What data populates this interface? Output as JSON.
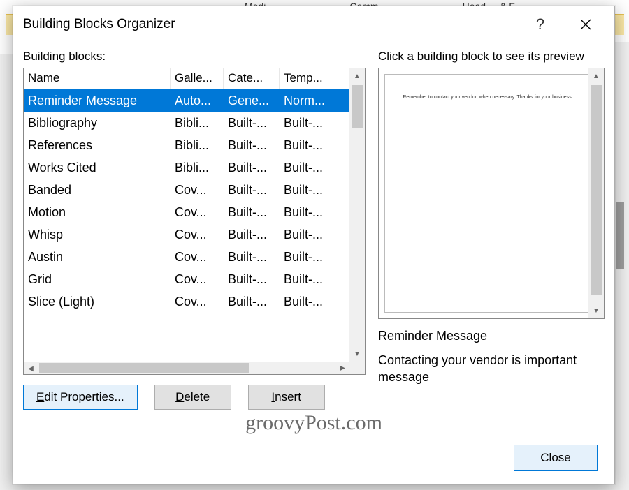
{
  "bg_ribbon": {
    "item1": "Medi",
    "item2": "Comm",
    "item3": "Head",
    "item4": "& F"
  },
  "dialog": {
    "title": "Building Blocks Organizer",
    "help_label": "?",
    "close_label": "✕"
  },
  "left": {
    "label_prefix": "B",
    "label_rest": "uilding blocks:",
    "columns": {
      "name": "Name",
      "gallery": "Galle...",
      "category": "Cate...",
      "template": "Temp..."
    },
    "rows": [
      {
        "name": "Reminder Message",
        "gallery": "Auto...",
        "category": "Gene...",
        "template": "Norm...",
        "selected": true
      },
      {
        "name": "Bibliography",
        "gallery": "Bibli...",
        "category": "Built-...",
        "template": "Built-...",
        "selected": false
      },
      {
        "name": "References",
        "gallery": "Bibli...",
        "category": "Built-...",
        "template": "Built-...",
        "selected": false
      },
      {
        "name": "Works Cited",
        "gallery": "Bibli...",
        "category": "Built-...",
        "template": "Built-...",
        "selected": false
      },
      {
        "name": "Banded",
        "gallery": "Cov...",
        "category": "Built-...",
        "template": "Built-...",
        "selected": false
      },
      {
        "name": "Motion",
        "gallery": "Cov...",
        "category": "Built-...",
        "template": "Built-...",
        "selected": false
      },
      {
        "name": "Whisp",
        "gallery": "Cov...",
        "category": "Built-...",
        "template": "Built-...",
        "selected": false
      },
      {
        "name": "Austin",
        "gallery": "Cov...",
        "category": "Built-...",
        "template": "Built-...",
        "selected": false
      },
      {
        "name": "Grid",
        "gallery": "Cov...",
        "category": "Built-...",
        "template": "Built-...",
        "selected": false
      },
      {
        "name": "Slice (Light)",
        "gallery": "Cov...",
        "category": "Built-...",
        "template": "Built-...",
        "selected": false
      }
    ],
    "buttons": {
      "edit_prefix": "E",
      "edit_rest": "dit Properties...",
      "delete_prefix": "D",
      "delete_rest": "elete",
      "insert_prefix": "I",
      "insert_rest": "nsert"
    }
  },
  "right": {
    "label": "Click a building block to see its preview",
    "preview_text": "Remember to contact your vendor, when necessary. Thanks for your business.",
    "preview_title": "Reminder Message",
    "preview_desc": "Contacting your vendor is important message"
  },
  "footer": {
    "close": "Close"
  },
  "watermark": "groovyPost.com"
}
